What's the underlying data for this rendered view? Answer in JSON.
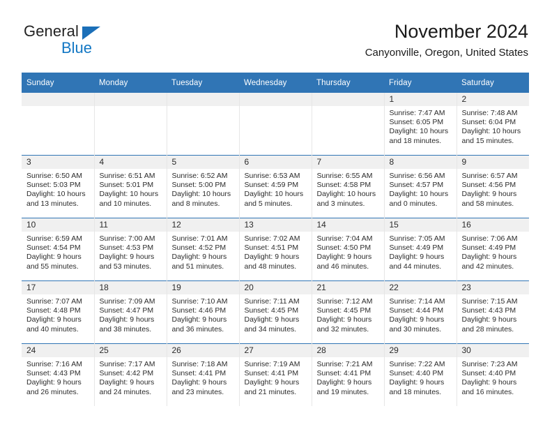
{
  "brand": {
    "word_one": "General",
    "word_two": "Blue",
    "triangle_color": "#1b6fb8",
    "blue_color": "#1277c4"
  },
  "header": {
    "title": "November 2024",
    "location": "Canyonville, Oregon, United States"
  },
  "theme": {
    "header_blue": "#3075b5",
    "daynum_band": "#f0f0f0",
    "text": "#2b2b2b"
  },
  "calendar": {
    "weekday_headers": [
      "Sunday",
      "Monday",
      "Tuesday",
      "Wednesday",
      "Thursday",
      "Friday",
      "Saturday"
    ],
    "weeks": [
      [
        {
          "day": "",
          "sunrise": "",
          "sunset": "",
          "daylight_line1": "",
          "daylight_line2": "",
          "blank": true
        },
        {
          "day": "",
          "sunrise": "",
          "sunset": "",
          "daylight_line1": "",
          "daylight_line2": "",
          "blank": true
        },
        {
          "day": "",
          "sunrise": "",
          "sunset": "",
          "daylight_line1": "",
          "daylight_line2": "",
          "blank": true
        },
        {
          "day": "",
          "sunrise": "",
          "sunset": "",
          "daylight_line1": "",
          "daylight_line2": "",
          "blank": true
        },
        {
          "day": "",
          "sunrise": "",
          "sunset": "",
          "daylight_line1": "",
          "daylight_line2": "",
          "blank": true
        },
        {
          "day": "1",
          "sunrise": "Sunrise: 7:47 AM",
          "sunset": "Sunset: 6:05 PM",
          "daylight_line1": "Daylight: 10 hours",
          "daylight_line2": "and 18 minutes."
        },
        {
          "day": "2",
          "sunrise": "Sunrise: 7:48 AM",
          "sunset": "Sunset: 6:04 PM",
          "daylight_line1": "Daylight: 10 hours",
          "daylight_line2": "and 15 minutes."
        }
      ],
      [
        {
          "day": "3",
          "sunrise": "Sunrise: 6:50 AM",
          "sunset": "Sunset: 5:03 PM",
          "daylight_line1": "Daylight: 10 hours",
          "daylight_line2": "and 13 minutes."
        },
        {
          "day": "4",
          "sunrise": "Sunrise: 6:51 AM",
          "sunset": "Sunset: 5:01 PM",
          "daylight_line1": "Daylight: 10 hours",
          "daylight_line2": "and 10 minutes."
        },
        {
          "day": "5",
          "sunrise": "Sunrise: 6:52 AM",
          "sunset": "Sunset: 5:00 PM",
          "daylight_line1": "Daylight: 10 hours",
          "daylight_line2": "and 8 minutes."
        },
        {
          "day": "6",
          "sunrise": "Sunrise: 6:53 AM",
          "sunset": "Sunset: 4:59 PM",
          "daylight_line1": "Daylight: 10 hours",
          "daylight_line2": "and 5 minutes."
        },
        {
          "day": "7",
          "sunrise": "Sunrise: 6:55 AM",
          "sunset": "Sunset: 4:58 PM",
          "daylight_line1": "Daylight: 10 hours",
          "daylight_line2": "and 3 minutes."
        },
        {
          "day": "8",
          "sunrise": "Sunrise: 6:56 AM",
          "sunset": "Sunset: 4:57 PM",
          "daylight_line1": "Daylight: 10 hours",
          "daylight_line2": "and 0 minutes."
        },
        {
          "day": "9",
          "sunrise": "Sunrise: 6:57 AM",
          "sunset": "Sunset: 4:56 PM",
          "daylight_line1": "Daylight: 9 hours",
          "daylight_line2": "and 58 minutes."
        }
      ],
      [
        {
          "day": "10",
          "sunrise": "Sunrise: 6:59 AM",
          "sunset": "Sunset: 4:54 PM",
          "daylight_line1": "Daylight: 9 hours",
          "daylight_line2": "and 55 minutes."
        },
        {
          "day": "11",
          "sunrise": "Sunrise: 7:00 AM",
          "sunset": "Sunset: 4:53 PM",
          "daylight_line1": "Daylight: 9 hours",
          "daylight_line2": "and 53 minutes."
        },
        {
          "day": "12",
          "sunrise": "Sunrise: 7:01 AM",
          "sunset": "Sunset: 4:52 PM",
          "daylight_line1": "Daylight: 9 hours",
          "daylight_line2": "and 51 minutes."
        },
        {
          "day": "13",
          "sunrise": "Sunrise: 7:02 AM",
          "sunset": "Sunset: 4:51 PM",
          "daylight_line1": "Daylight: 9 hours",
          "daylight_line2": "and 48 minutes."
        },
        {
          "day": "14",
          "sunrise": "Sunrise: 7:04 AM",
          "sunset": "Sunset: 4:50 PM",
          "daylight_line1": "Daylight: 9 hours",
          "daylight_line2": "and 46 minutes."
        },
        {
          "day": "15",
          "sunrise": "Sunrise: 7:05 AM",
          "sunset": "Sunset: 4:49 PM",
          "daylight_line1": "Daylight: 9 hours",
          "daylight_line2": "and 44 minutes."
        },
        {
          "day": "16",
          "sunrise": "Sunrise: 7:06 AM",
          "sunset": "Sunset: 4:49 PM",
          "daylight_line1": "Daylight: 9 hours",
          "daylight_line2": "and 42 minutes."
        }
      ],
      [
        {
          "day": "17",
          "sunrise": "Sunrise: 7:07 AM",
          "sunset": "Sunset: 4:48 PM",
          "daylight_line1": "Daylight: 9 hours",
          "daylight_line2": "and 40 minutes."
        },
        {
          "day": "18",
          "sunrise": "Sunrise: 7:09 AM",
          "sunset": "Sunset: 4:47 PM",
          "daylight_line1": "Daylight: 9 hours",
          "daylight_line2": "and 38 minutes."
        },
        {
          "day": "19",
          "sunrise": "Sunrise: 7:10 AM",
          "sunset": "Sunset: 4:46 PM",
          "daylight_line1": "Daylight: 9 hours",
          "daylight_line2": "and 36 minutes."
        },
        {
          "day": "20",
          "sunrise": "Sunrise: 7:11 AM",
          "sunset": "Sunset: 4:45 PM",
          "daylight_line1": "Daylight: 9 hours",
          "daylight_line2": "and 34 minutes."
        },
        {
          "day": "21",
          "sunrise": "Sunrise: 7:12 AM",
          "sunset": "Sunset: 4:45 PM",
          "daylight_line1": "Daylight: 9 hours",
          "daylight_line2": "and 32 minutes."
        },
        {
          "day": "22",
          "sunrise": "Sunrise: 7:14 AM",
          "sunset": "Sunset: 4:44 PM",
          "daylight_line1": "Daylight: 9 hours",
          "daylight_line2": "and 30 minutes."
        },
        {
          "day": "23",
          "sunrise": "Sunrise: 7:15 AM",
          "sunset": "Sunset: 4:43 PM",
          "daylight_line1": "Daylight: 9 hours",
          "daylight_line2": "and 28 minutes."
        }
      ],
      [
        {
          "day": "24",
          "sunrise": "Sunrise: 7:16 AM",
          "sunset": "Sunset: 4:43 PM",
          "daylight_line1": "Daylight: 9 hours",
          "daylight_line2": "and 26 minutes."
        },
        {
          "day": "25",
          "sunrise": "Sunrise: 7:17 AM",
          "sunset": "Sunset: 4:42 PM",
          "daylight_line1": "Daylight: 9 hours",
          "daylight_line2": "and 24 minutes."
        },
        {
          "day": "26",
          "sunrise": "Sunrise: 7:18 AM",
          "sunset": "Sunset: 4:41 PM",
          "daylight_line1": "Daylight: 9 hours",
          "daylight_line2": "and 23 minutes."
        },
        {
          "day": "27",
          "sunrise": "Sunrise: 7:19 AM",
          "sunset": "Sunset: 4:41 PM",
          "daylight_line1": "Daylight: 9 hours",
          "daylight_line2": "and 21 minutes."
        },
        {
          "day": "28",
          "sunrise": "Sunrise: 7:21 AM",
          "sunset": "Sunset: 4:41 PM",
          "daylight_line1": "Daylight: 9 hours",
          "daylight_line2": "and 19 minutes."
        },
        {
          "day": "29",
          "sunrise": "Sunrise: 7:22 AM",
          "sunset": "Sunset: 4:40 PM",
          "daylight_line1": "Daylight: 9 hours",
          "daylight_line2": "and 18 minutes."
        },
        {
          "day": "30",
          "sunrise": "Sunrise: 7:23 AM",
          "sunset": "Sunset: 4:40 PM",
          "daylight_line1": "Daylight: 9 hours",
          "daylight_line2": "and 16 minutes."
        }
      ]
    ]
  }
}
